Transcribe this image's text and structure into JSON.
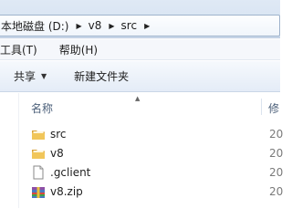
{
  "address": {
    "crumbs": [
      "本地磁盘 (D:)",
      "v8",
      "src"
    ]
  },
  "menu": {
    "items": [
      "工具(T)",
      "帮助(H)"
    ]
  },
  "toolbar": {
    "share_label": "共享",
    "new_folder_label": "新建文件夹"
  },
  "columns": {
    "name": "名称",
    "modified": "修"
  },
  "files": [
    {
      "name": "src",
      "date": "20",
      "icon": "folder-icon"
    },
    {
      "name": "v8",
      "date": "20",
      "icon": "folder-icon"
    },
    {
      "name": ".gclient",
      "date": "20",
      "icon": "file-icon"
    },
    {
      "name": "v8.zip",
      "date": "20",
      "icon": "zip-archive-icon"
    }
  ],
  "colors": {
    "folder": "#e8b84a",
    "header_text": "#4c607a",
    "date_text": "#7a7a7a"
  }
}
